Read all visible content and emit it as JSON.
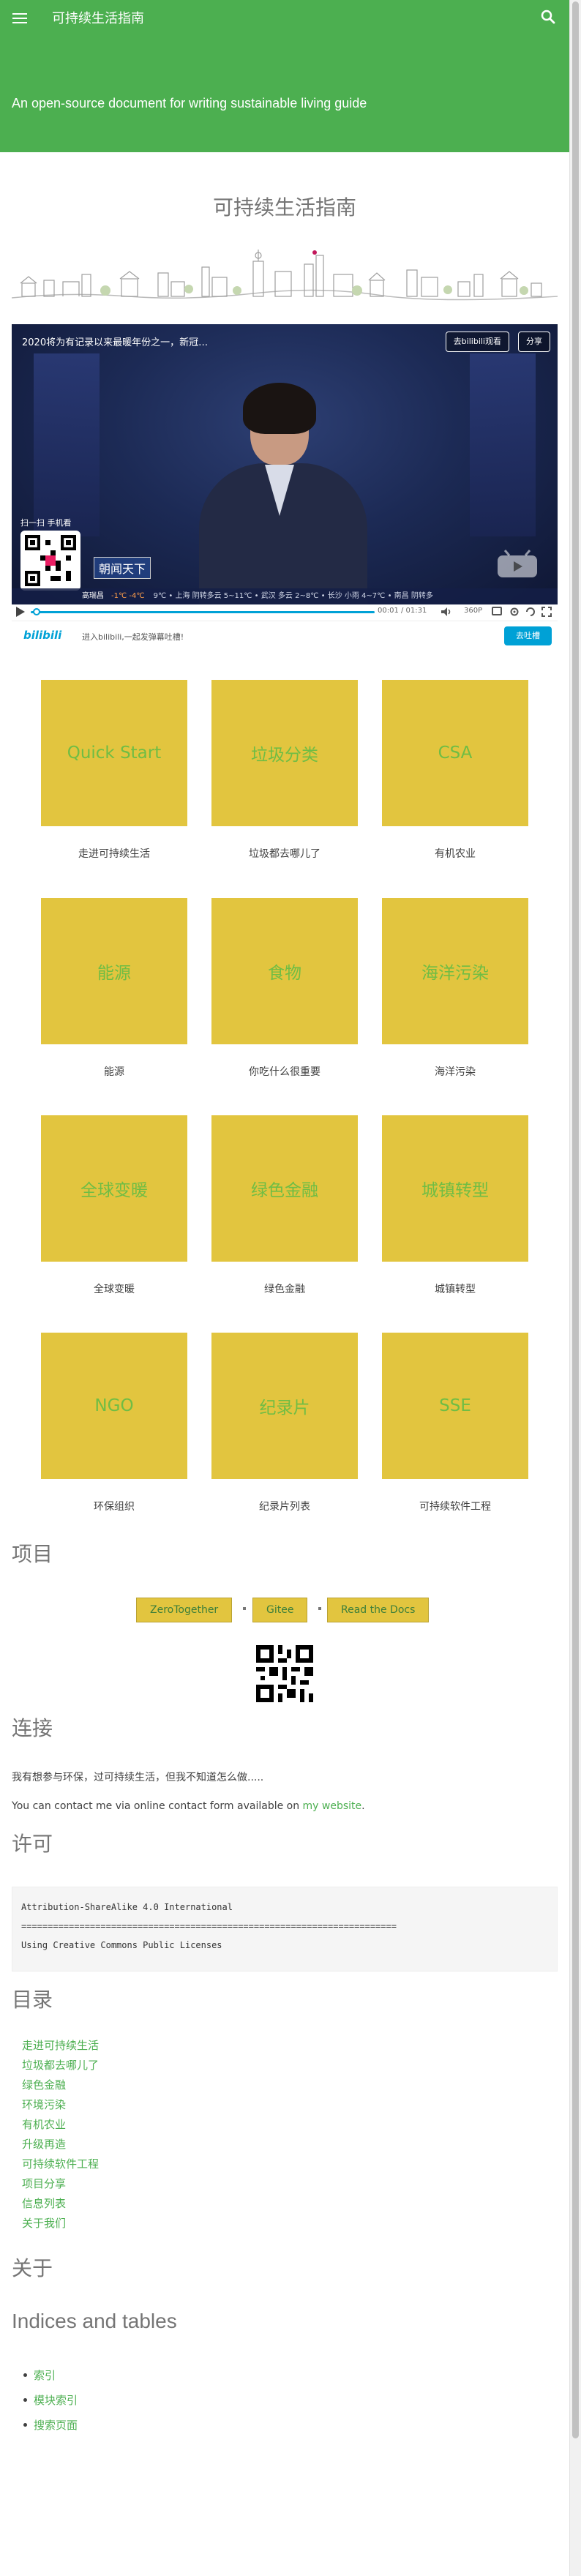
{
  "header": {
    "site_title": "可持续生活指南",
    "tagline": "An open-source document for writing sustainable living guide"
  },
  "page_title": "可持续生活指南",
  "video": {
    "title": "2020将为有记录以来最暖年份之一，新冠…",
    "watch_label": "去bilibili观看",
    "share_label": "分享",
    "scan_label": "扫一扫 手机看",
    "channel_logo": "朝闻天下",
    "ticker_anchor": "高瑞昌",
    "ticker_temp": "-1℃ -4℃",
    "ticker_text": "9℃ • 上海 阴转多云 5~11℃ • 武汉 多云 2~8℃ • 长沙 小雨 4~7℃ • 南昌 阴转多",
    "time": "00:01 / 01:31",
    "quality": "360P",
    "progress": 0.01
  },
  "bili_bar": {
    "logo": "bilibili",
    "text": "进入bilibili,一起发弹幕吐槽!",
    "button": "去吐槽"
  },
  "cards": [
    {
      "label": "Quick Start",
      "caption": "走进可持续生活"
    },
    {
      "label": "垃圾分类",
      "caption": "垃圾都去哪儿了"
    },
    {
      "label": "CSA",
      "caption": "有机农业"
    },
    {
      "label": "能源",
      "caption": "能源"
    },
    {
      "label": "食物",
      "caption": "你吃什么很重要"
    },
    {
      "label": "海洋污染",
      "caption": "海洋污染"
    },
    {
      "label": "全球变暖",
      "caption": "全球变暖"
    },
    {
      "label": "绿色金融",
      "caption": "绿色金融"
    },
    {
      "label": "城镇转型",
      "caption": "城镇转型"
    },
    {
      "label": "NGO",
      "caption": "环保组织"
    },
    {
      "label": "纪录片",
      "caption": "纪录片列表"
    },
    {
      "label": "SSE",
      "caption": "可持续软件工程"
    }
  ],
  "sections": {
    "project": "项目",
    "contact": "连接",
    "license": "许可",
    "toc": "目录",
    "about": "关于",
    "indices": "Indices and tables"
  },
  "project_buttons": [
    "ZeroTogether",
    "Gitee",
    "Read the Docs"
  ],
  "contact": {
    "line1": "我有想参与环保，过可持续生活，但我不知道怎么做.....",
    "line2_prefix": "You can contact me via online contact form available on ",
    "line2_link": "my website",
    "line2_suffix": "."
  },
  "license_code": [
    "Attribution-ShareAlike 4.0 International",
    "=======================================================================",
    "Using Creative Commons Public Licenses"
  ],
  "toc_items": [
    "走进可持续生活",
    "垃圾都去哪儿了",
    "绿色金融",
    "环境污染",
    "有机农业",
    "升级再造",
    "可持续软件工程",
    "项目分享",
    "信息列表",
    "关于我们"
  ],
  "index_items": [
    "索引",
    "模块索引",
    "搜索页面"
  ],
  "colors": {
    "header_green": "#4caf50",
    "card_yellow": "#e2c53f",
    "card_text_green": "#6fbd44",
    "link_green": "#4caf50",
    "bili_blue": "#00a1d6"
  }
}
